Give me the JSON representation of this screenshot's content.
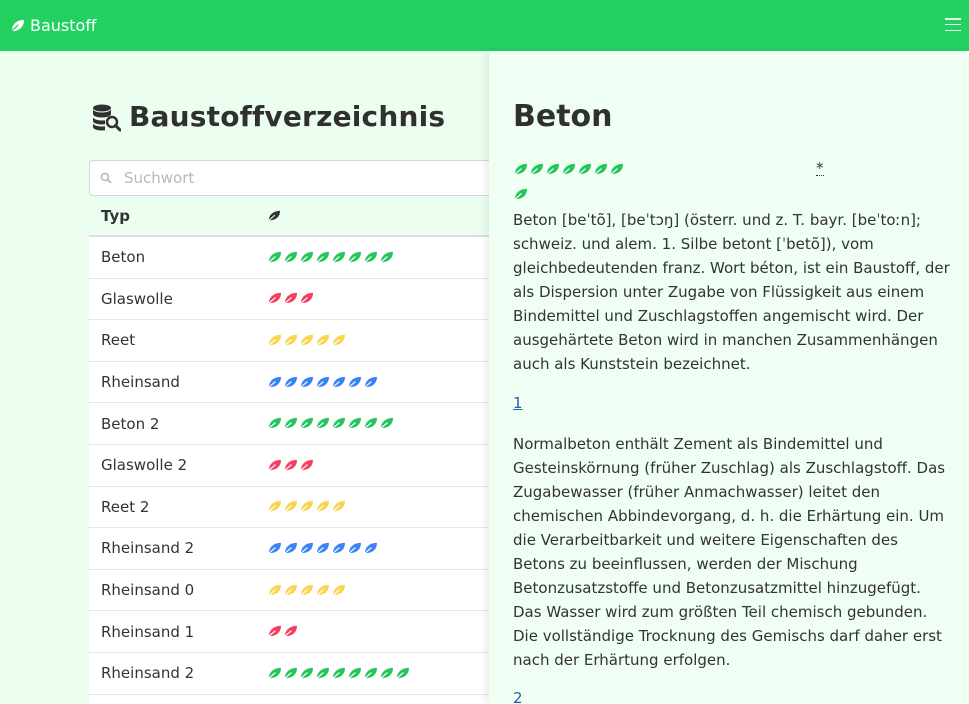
{
  "navbar": {
    "brand": "Baustoff",
    "menu_icon": "hamburger-menu-icon"
  },
  "left": {
    "title": "Baustoffverzeichnis",
    "search": {
      "placeholder": "Suchwort",
      "value": ""
    },
    "columns": {
      "type": "Typ",
      "rating_icon": "leaf-icon"
    },
    "rows": [
      {
        "name": "Beton",
        "leaves": 8,
        "color": "#22c55e"
      },
      {
        "name": "Glaswolle",
        "leaves": 3,
        "color": "#f43f5e"
      },
      {
        "name": "Reet",
        "leaves": 5,
        "color": "#fcd34d"
      },
      {
        "name": "Rheinsand",
        "leaves": 7,
        "color": "#3b82f6"
      },
      {
        "name": "Beton 2",
        "leaves": 8,
        "color": "#22c55e"
      },
      {
        "name": "Glaswolle 2",
        "leaves": 3,
        "color": "#f43f5e"
      },
      {
        "name": "Reet 2",
        "leaves": 5,
        "color": "#fcd34d"
      },
      {
        "name": "Rheinsand 2",
        "leaves": 7,
        "color": "#3b82f6"
      },
      {
        "name": "Rheinsand 0",
        "leaves": 5,
        "color": "#fcd34d"
      },
      {
        "name": "Rheinsand 1",
        "leaves": 2,
        "color": "#f43f5e"
      },
      {
        "name": "Rheinsand 2",
        "leaves": 9,
        "color": "#22c55e"
      },
      {
        "name": "",
        "leaves": 0,
        "color": "#22c55e"
      }
    ]
  },
  "detail": {
    "title": "Beton",
    "rating": {
      "leaves": 7,
      "extra_leaves": 1,
      "color": "#22c55e"
    },
    "footnote_mark": "*",
    "paragraph1": "Beton [beˈtõ], [beˈtɔŋ] (österr. und z. T. bayr. [beˈtoːn]; schweiz. und alem. 1. Silbe betont [ˈbetõ]), vom gleichbedeutenden franz. Wort béton, ist ein Baustoff, der als Dispersion unter Zugabe von Flüssigkeit aus einem Bindemittel und Zuschlagstoffen angemischt wird. Der ausgehärtete Beton wird in manchen Zusammenhängen auch als Kunststein bezeichnet.",
    "ref1": "1",
    "paragraph2": "Normalbeton enthält Zement als Bindemittel und Gesteinskörnung (früher Zuschlag) als Zuschlagstoff. Das Zugabewasser (früher Anmachwasser) leitet den chemischen Abbindevorgang, d. h. die Erhärtung ein. Um die Verarbeitbarkeit und weitere Eigenschaften des Betons zu beeinflussen, werden der Mischung Betonzusatzstoffe und Betonzusatzmittel hinzugefügt. Das Wasser wird zum größten Teil chemisch gebunden. Die vollständige Trocknung des Gemischs darf daher erst nach der Erhärtung erfolgen.",
    "ref2": "2"
  }
}
